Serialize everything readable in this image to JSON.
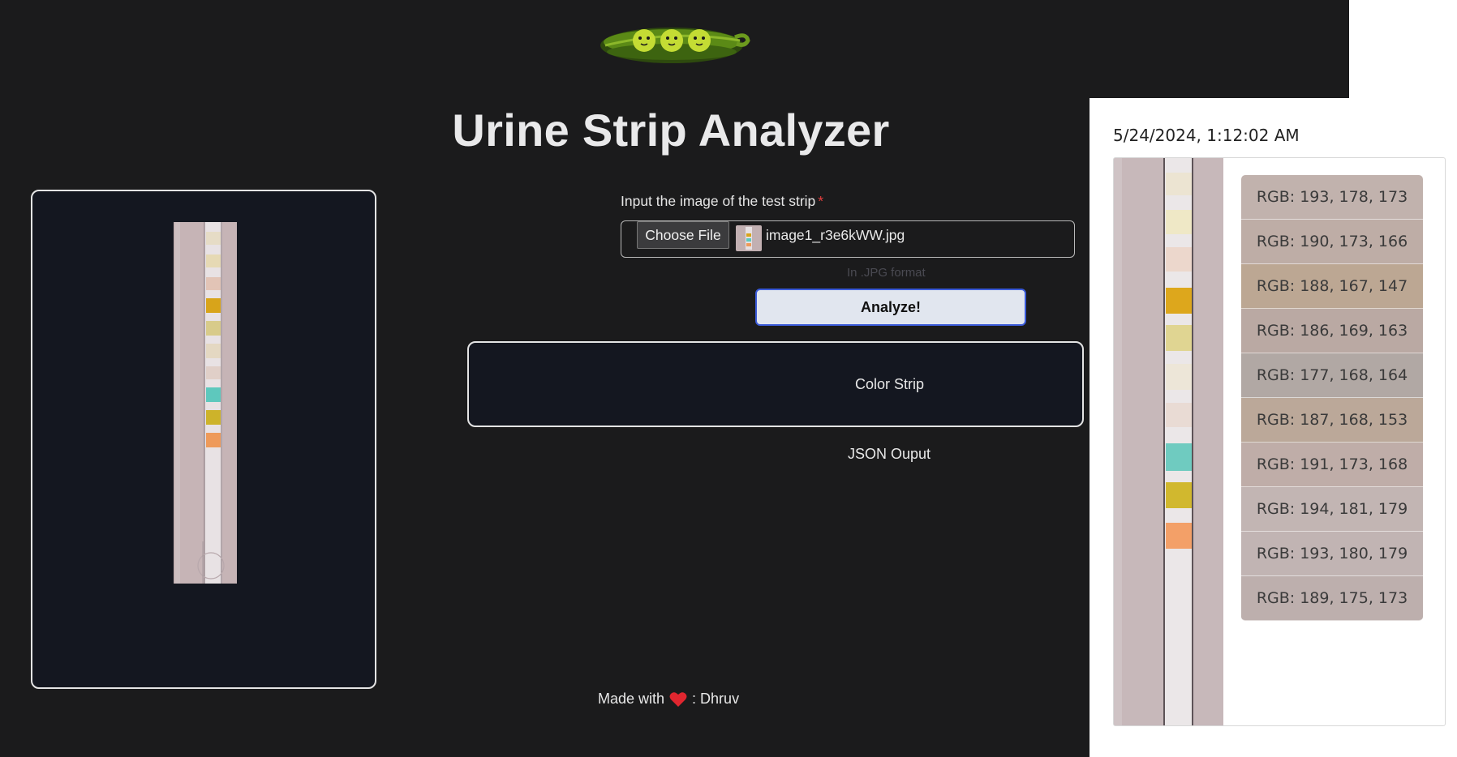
{
  "app": {
    "title": "Urine Strip Analyzer",
    "logo_icon": "pea-pod-logo-icon"
  },
  "upload": {
    "label": "Input the image of the test strip",
    "required_mark": "*",
    "choose_button": "Choose File",
    "file_name": "image1_r3e6kWW.jpg",
    "hint": "In .JPG format"
  },
  "actions": {
    "analyze_label": "Analyze!"
  },
  "results": {
    "color_strip_label": "Color Strip",
    "json_output_label": "JSON Ouput"
  },
  "footer": {
    "made_with": "Made with",
    "heart_icon": "heart-icon",
    "author": ": Dhruv"
  },
  "overlay": {
    "timestamp": "5/24/2024, 1:12:02 AM",
    "rgb_values": [
      {
        "label": "RGB: 193, 178, 173",
        "color": "#c1b2ad"
      },
      {
        "label": "RGB: 190, 173, 166",
        "color": "#beada6"
      },
      {
        "label": "RGB: 188, 167, 147",
        "color": "#bca793"
      },
      {
        "label": "RGB: 186, 169, 163",
        "color": "#baa9a3"
      },
      {
        "label": "RGB: 177, 168, 164",
        "color": "#b1a8a4"
      },
      {
        "label": "RGB: 187, 168, 153",
        "color": "#bba899"
      },
      {
        "label": "RGB: 191, 173, 168",
        "color": "#bfada8"
      },
      {
        "label": "RGB: 194, 181, 179",
        "color": "#c2b5b3"
      },
      {
        "label": "RGB: 193, 180, 179",
        "color": "#c1b4b3"
      },
      {
        "label": "RGB: 189, 175, 173",
        "color": "#bdafad"
      }
    ]
  },
  "colors": {
    "background": "#1b1b1c",
    "panel": "#141720",
    "accent_border": "#3b5bd9",
    "required": "#e53e3e"
  }
}
